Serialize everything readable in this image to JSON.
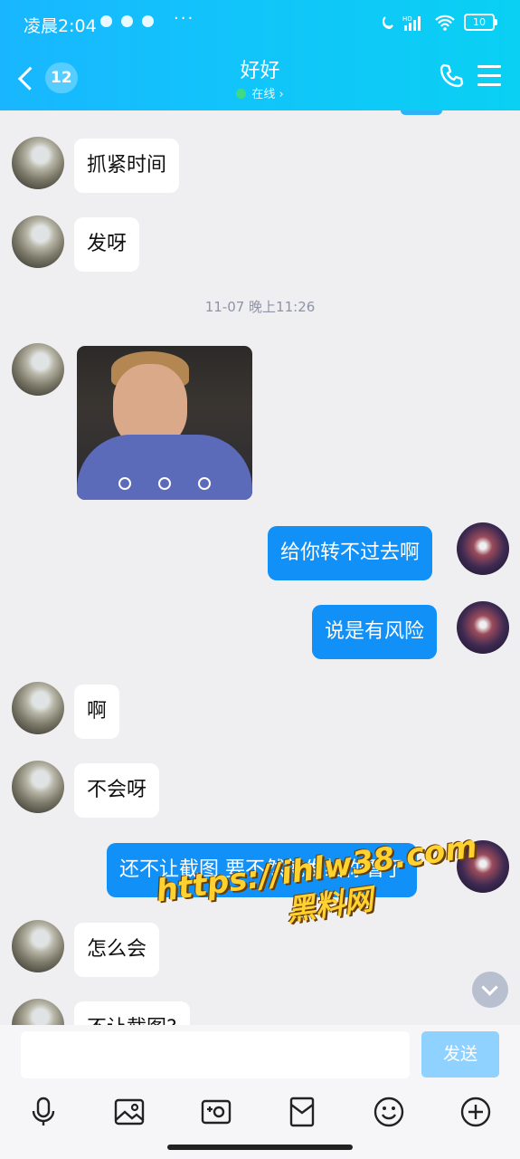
{
  "status_bar": {
    "time": "凌晨2:04",
    "battery": "10",
    "network": "HD"
  },
  "header": {
    "back_count": "12",
    "title": "好好",
    "status": "在线 ›"
  },
  "messages": [
    {
      "side": "in",
      "text": "抓紧时间"
    },
    {
      "side": "in",
      "text": "发呀"
    },
    {
      "type": "timestamp",
      "text": "11-07 晚上11:26"
    },
    {
      "side": "in",
      "type": "image"
    },
    {
      "side": "out",
      "text": "给你转不过去啊"
    },
    {
      "side": "out",
      "text": "说是有风险"
    },
    {
      "side": "in",
      "text": "啊"
    },
    {
      "side": "in",
      "text": "不会呀"
    },
    {
      "side": "out",
      "text": "还不让截图 要不然就发给你看了"
    },
    {
      "side": "in",
      "text": "怎么会"
    },
    {
      "side": "in",
      "text": "不让截图?"
    }
  ],
  "watermark": {
    "url": "https://ihlw38.com",
    "name": "黑料网"
  },
  "composer": {
    "placeholder": "",
    "send_label": "发送"
  },
  "toolbar_icons": [
    "microphone-icon",
    "image-icon",
    "camera-icon",
    "red-packet-icon",
    "emoji-icon",
    "plus-icon"
  ],
  "colors": {
    "header": "#12c3fb",
    "bubble_out": "#1190f7",
    "send_disabled": "#90d2ff"
  }
}
